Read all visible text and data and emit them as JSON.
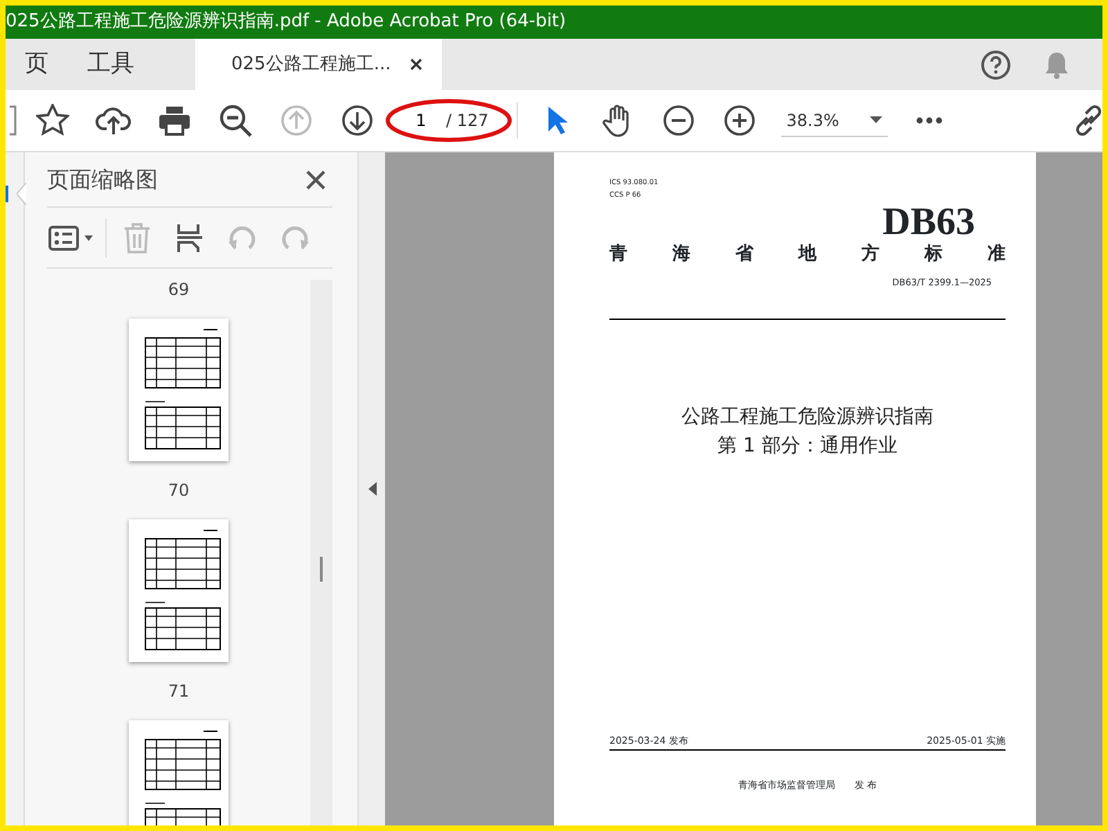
{
  "window": {
    "title": "025公路工程施工危险源辨识指南.pdf - Adobe Acrobat Pro (64-bit)"
  },
  "tabs": [
    {
      "label": "页",
      "selected": false
    },
    {
      "label": "工具",
      "selected": false
    },
    {
      "label": "025公路工程施工...",
      "selected": true
    }
  ],
  "toolbar": {
    "page_input": "1",
    "page_total": "/ 127",
    "zoom": "38.3%"
  },
  "sidebar": {
    "title": "页面缩略图",
    "page_labels": [
      "69",
      "70",
      "71"
    ]
  },
  "document": {
    "ics": "ICS 93.080.01",
    "ccs": "CCS P 66",
    "code": "DB63",
    "standard_type": "青 海 省 地 方 标 准",
    "number": "DB63/T 2399.1—2025",
    "title_lines": [
      "公路工程施工危险源辨识指南",
      "第 1 部分：通用作业"
    ],
    "issue_date": "2025-03-24 发布",
    "effective_date": "2025-05-01 实施",
    "issuer": "青海省市场监督管理局",
    "issuer_action": "发 布"
  }
}
